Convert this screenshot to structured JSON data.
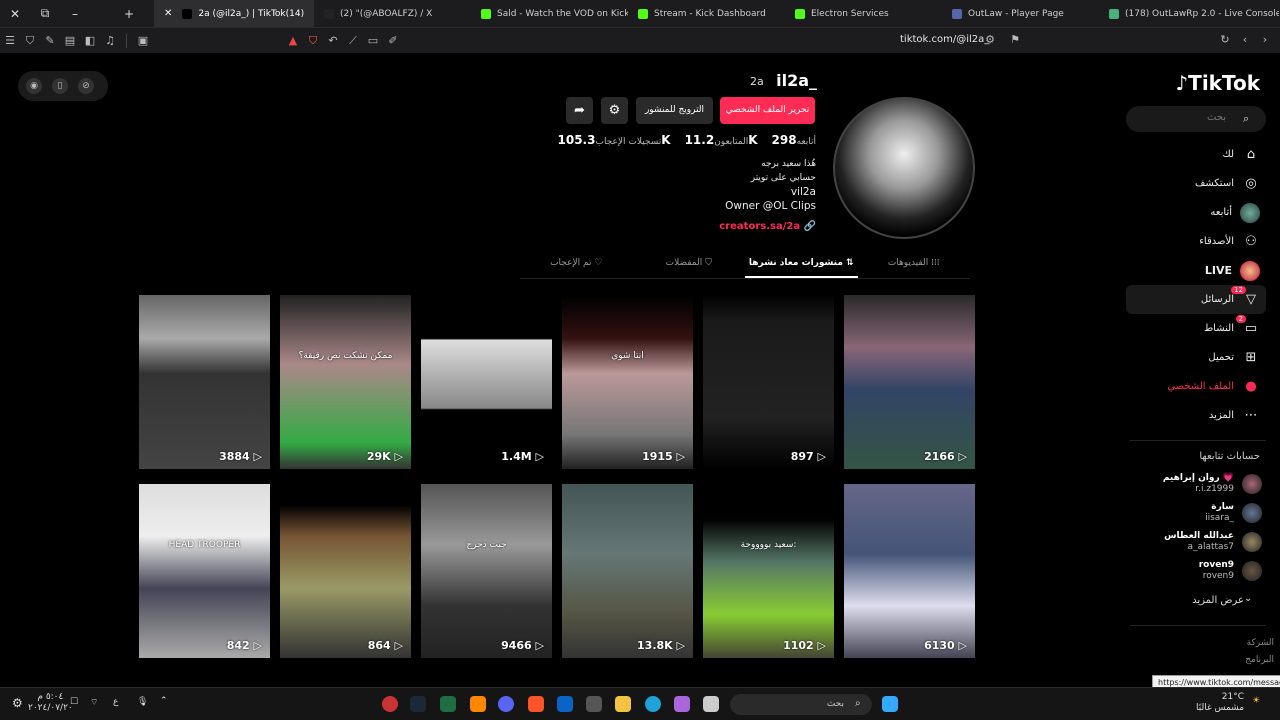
{
  "browser": {
    "tabs": [
      {
        "title": "2a (@il2a_) | TikTok(14)",
        "active": true,
        "color": "#000000"
      },
      {
        "title": "(2) \"(@ABOALFZ) / X",
        "active": false,
        "color": "#222222"
      },
      {
        "title": "Sald - Watch the VOD on Kick",
        "active": false,
        "color": "#53fc18"
      },
      {
        "title": "Stream - Kick Dashboard",
        "active": false,
        "color": "#53fc18"
      },
      {
        "title": "Electron Services",
        "active": false,
        "color": "#53fc18"
      },
      {
        "title": "OutLaw - Player Page",
        "active": false,
        "color": "#5566aa"
      },
      {
        "title": "(178) OutLawRp 2.0 - Live Console",
        "active": false,
        "color": "#4ab07a"
      }
    ],
    "url": "tiktok.com/@il2a_"
  },
  "logo": "TikTok",
  "search_placeholder": "بحث",
  "nav": [
    {
      "label": "لك",
      "icon": "home-icon",
      "glyph": "⌂"
    },
    {
      "label": "استكشف",
      "icon": "compass-icon",
      "glyph": "◎"
    },
    {
      "label": "أتابعه",
      "icon": "following-avatar",
      "glyph": ""
    },
    {
      "label": "الأصدقاء",
      "icon": "friends-icon",
      "glyph": "⚇"
    },
    {
      "label": "LIVE",
      "icon": "live-avatar",
      "glyph": ""
    },
    {
      "label": "الرسائل",
      "icon": "messages-icon",
      "glyph": "▽",
      "badge": "12"
    },
    {
      "label": "النشاط",
      "icon": "activity-icon",
      "glyph": "▭",
      "badge": "2"
    },
    {
      "label": "تحميل",
      "icon": "upload-icon",
      "glyph": "⊞"
    },
    {
      "label": "الملف الشخصي",
      "icon": "profile-icon",
      "glyph": "●"
    },
    {
      "label": "المزيد",
      "icon": "more-icon",
      "glyph": "⋯"
    }
  ],
  "following_title": "حسابات تتابعها",
  "following": [
    {
      "name": "روان إبراهيم 💗",
      "user": "r.i.z1999",
      "color": "#a67"
    },
    {
      "name": "سارة",
      "user": "iisara_",
      "color": "#679"
    },
    {
      "name": "عبدالله العطاس",
      "user": "a_alattas7",
      "color": "#986"
    },
    {
      "name": "roven9",
      "user": "roven9",
      "color": "#654"
    }
  ],
  "see_more": "عرض المزيد",
  "footer": [
    "الشركة",
    "البرنامج"
  ],
  "tooltip": "https://www.tiktok.com/messages",
  "profile": {
    "username": "il2a_",
    "nickname": "2a",
    "edit_button": "تحرير الملف الشخصي",
    "promote_button": "الترويج للمنشور",
    "stats": [
      {
        "num": "298",
        "label": "أتابعه"
      },
      {
        "num": "11.2K",
        "label": "المتابعون"
      },
      {
        "num": "105.3K",
        "label": "تسجيلات الإعجاب"
      }
    ],
    "bio": [
      "هُذا سعيد برجه",
      "حسابي على تويتر",
      "vil2a",
      "Owner @OL Clips"
    ],
    "link": "creators.sa/2a"
  },
  "tabs": [
    {
      "label": "الفيديوهات ⁞⁞⁞",
      "active": false
    },
    {
      "label": "منشورات معاد نشرها ⇅",
      "active": true
    },
    {
      "label": "المفضلات ⛉",
      "active": false
    },
    {
      "label": "تم الإعجاب ♡",
      "active": false
    }
  ],
  "videos": [
    {
      "count": "3884",
      "bg": "linear-gradient(#666 0%, #aaa 25%, #333 45%, #444 100%)",
      "caption": ""
    },
    {
      "count": "29K",
      "bg": "linear-gradient(#222 0%, #a88 40%, #3a4 85%, #333 100%)",
      "caption": "ممكن تشكت نص رقيقة؟"
    },
    {
      "count": "1.4M",
      "bg": "linear-gradient(#000 0%, #000 25%, #ddd 26%, #888 65%, #000 66%)",
      "caption": ""
    },
    {
      "count": "1915",
      "bg": "linear-gradient(#000 0%, #311 25%, #b99 45%, #777 80%, #222 100%)",
      "caption": "انتا شوي"
    },
    {
      "count": "897",
      "bg": "linear-gradient(#000 0%, #1a1a1a 15%, #222 70%, #000 100%)",
      "caption": ""
    },
    {
      "count": "2166",
      "bg": "linear-gradient(#2a2a2a 0%, #867 30%, #346 55%, #354 100%)",
      "caption": ""
    },
    {
      "count": "842",
      "bg": "linear-gradient(#ddd 0%, #eee 30%, #445 60%, #aaa 100%)",
      "caption": "HEAD TROOPER"
    },
    {
      "count": "864",
      "bg": "linear-gradient(#000 0%, #000 12%, #753 30%, #996 60%, #333 100%)",
      "caption": ""
    },
    {
      "count": "9466",
      "bg": "linear-gradient(#555 0%, #999 35%, #333 70%, #222 100%)",
      "caption": "جبت دحرج"
    },
    {
      "count": "13.8K",
      "bg": "linear-gradient(#455 0%, #677 40%, #554 75%, #333 100%)",
      "caption": ""
    },
    {
      "count": "1102",
      "bg": "linear-gradient(#000 0%, #000 20%, #576 45%, #8c3 75%, #443 100%)",
      "caption": "سعيد بووووحة:"
    },
    {
      "count": "6130",
      "bg": "linear-gradient(#668 0%, #457 40%, #dde 70%, #445 100%)",
      "caption": ""
    }
  ],
  "taskbar": {
    "search": "بحث",
    "weather_temp": "21°C",
    "weather_text": "مشمس غالبًا",
    "time": "٥:٠٤ م",
    "date": "٢٠٢٤/٠٧/٢٠",
    "lang": "ع"
  }
}
